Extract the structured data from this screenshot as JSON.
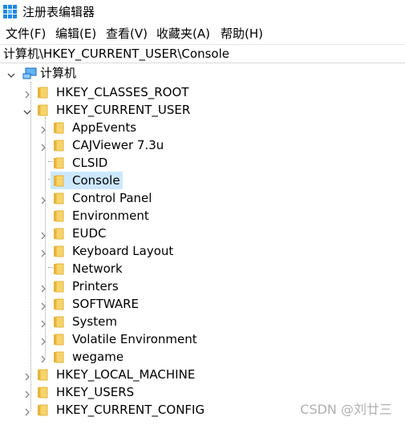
{
  "window": {
    "title": "注册表编辑器",
    "icon": "registry-editor-icon"
  },
  "menu": [
    "文件(F)",
    "编辑(E)",
    "查看(V)",
    "收藏夹(A)",
    "帮助(H)"
  ],
  "address": "计算机\\HKEY_CURRENT_USER\\Console",
  "tree": {
    "root": "计算机",
    "hives": {
      "classes_root": "HKEY_CLASSES_ROOT",
      "current_user": "HKEY_CURRENT_USER",
      "local_machine": "HKEY_LOCAL_MACHINE",
      "users": "HKEY_USERS",
      "current_config": "HKEY_CURRENT_CONFIG"
    },
    "current_user_children": [
      "AppEvents",
      "CAJViewer 7.3u",
      "CLSID",
      "Console",
      "Control Panel",
      "Environment",
      "EUDC",
      "Keyboard Layout",
      "Network",
      "Printers",
      "SOFTWARE",
      "System",
      "Volatile Environment",
      "wegame"
    ],
    "selected": "Console"
  },
  "watermark": "CSDN @刘廿三",
  "colors": {
    "selection": "#cce8ff",
    "folder": "#f7d46b",
    "folder_dark": "#e6b43c",
    "title_icon": "#1e88e5"
  }
}
